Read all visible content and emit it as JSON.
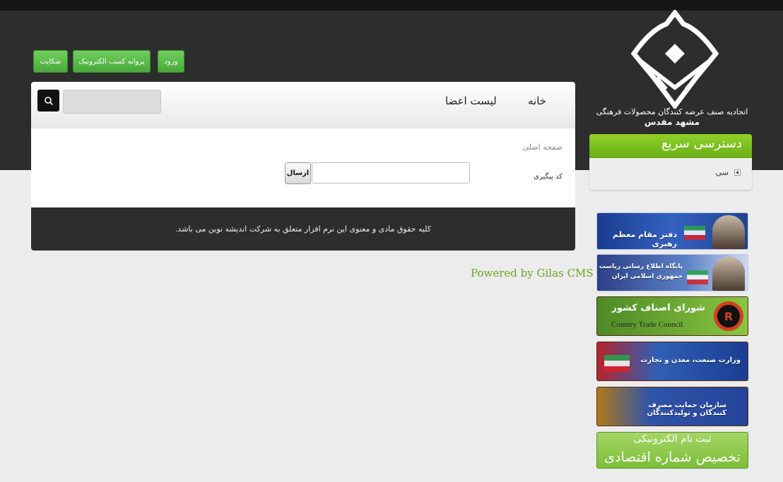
{
  "header": {
    "buttons": [
      {
        "label": "شکایت"
      },
      {
        "label": "پروانه کسب الکترونیک"
      },
      {
        "label": "ورود"
      }
    ],
    "org_name": "اتحادیه صنف عرضه کنندگان محصولات فرهنگی",
    "org_city": "مشهد مقدس"
  },
  "nav": {
    "items": [
      {
        "label": "خانه"
      },
      {
        "label": "لیست اعضا"
      }
    ],
    "search_icon": "search-icon"
  },
  "content": {
    "breadcrumb": "صفحه اصلی",
    "tracking_label": "کد پیگیری",
    "send_label": "ارسال"
  },
  "footer": {
    "copyright": "کلیه حقوق مادی و معنوی این نرم افزار متعلق به شرکت اندیشه نوین می باشد."
  },
  "powered_by": "Powered by Gilas CMS",
  "quick_access": {
    "title": "دسترسی سریع",
    "items": [
      {
        "label": "سی"
      }
    ]
  },
  "banners": {
    "b1_text": "دفتر مقام معظم رهبری",
    "b2_text": "پایگاه اطلاع رسانی ریاست جمهوری اسلامی ایران",
    "b3_title": "شورای اصناف کشور",
    "b3_sub": "Country Trade Council",
    "b4_text": "وزارت صنعت، معدن و تجارت",
    "b5_text": "سازمان حمایت مصرف کنندگان و تولیدکنندگان",
    "b6_line1": "ثبت نام الکترونیکی",
    "b6_line2": "تخصیص شماره اقتصادی"
  },
  "colors": {
    "accent_green": "#6aae18",
    "header_dark": "#2d2d2d"
  }
}
